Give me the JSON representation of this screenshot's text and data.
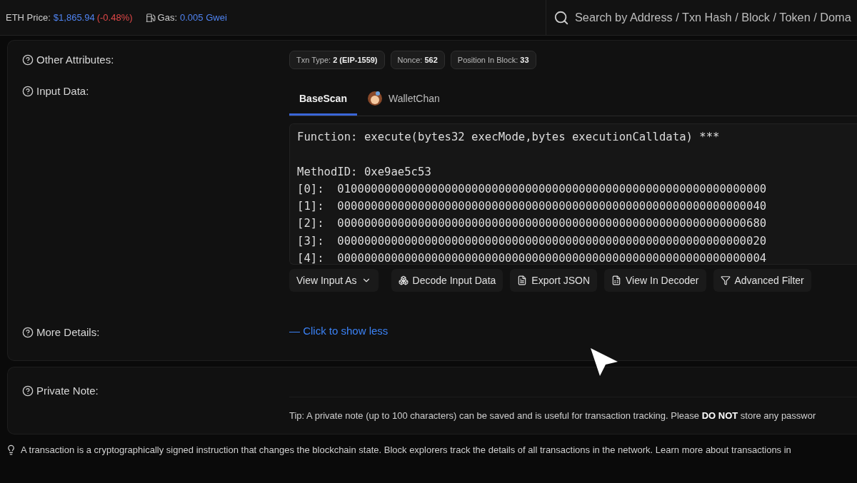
{
  "top_bar": {
    "eth_price_label": "ETH Price:",
    "eth_price": "$1,865.94",
    "eth_change": "(-0.48%)",
    "gas_label": "Gas:",
    "gas_value": "0.005 Gwei",
    "search": {
      "placeholder": "Search by Address / Txn Hash / Block / Token / Doma"
    }
  },
  "other_attributes": {
    "label": "Other Attributes:",
    "badges": [
      {
        "name": "Txn Type:",
        "value": "2 (EIP-1559)"
      },
      {
        "name": "Nonce:",
        "value": "562"
      },
      {
        "name": "Position In Block:",
        "value": "33"
      }
    ]
  },
  "input_data": {
    "label": "Input Data:",
    "tabs": [
      {
        "label": "BaseScan",
        "selected": true,
        "kind": "text"
      },
      {
        "label": "WalletChan",
        "selected": false,
        "kind": "avatar"
      }
    ],
    "function_line": "Function: execute(bytes32 execMode,bytes executionCalldata) ***",
    "lines": [
      "MethodID: 0xe9ae5c53",
      "[0]:  0100000000000000000000000000000000000000000000000000000000000000",
      "[1]:  0000000000000000000000000000000000000000000000000000000000000040",
      "[2]:  0000000000000000000000000000000000000000000000000000000000000680",
      "[3]:  0000000000000000000000000000000000000000000000000000000000000020",
      "[4]:  0000000000000000000000000000000000000000000000000000000000000004"
    ],
    "buttons": [
      {
        "label": "View Input As",
        "kind": "dropdown"
      },
      {
        "label": "Decode Input Data",
        "kind": "decode"
      },
      {
        "label": "Export JSON",
        "kind": "file"
      },
      {
        "label": "View In Decoder",
        "kind": "sheet"
      },
      {
        "label": "Advanced Filter",
        "kind": "filter"
      }
    ]
  },
  "more_details": {
    "label": "More Details:",
    "link": "— Click to show less"
  },
  "private_note": {
    "label": "Private Note:",
    "tip": "Tip: A private note (up to 100 characters) can be saved and is useful for transaction tracking. Please **DO NOT** store any passwor"
  },
  "footer_tip": "A transaction is a cryptographically signed instruction that changes the blockchain state. Block explorers track the details of all transactions in the network. Learn more about transactions in"
}
